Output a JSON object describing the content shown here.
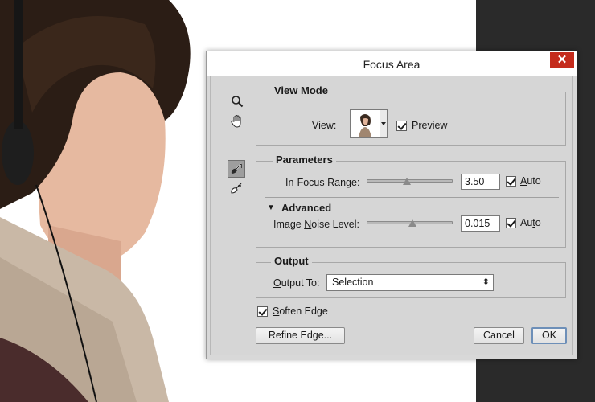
{
  "dialog": {
    "title": "Focus Area",
    "close_glyph": "✕"
  },
  "tools": [
    {
      "icon": "zoom-icon"
    },
    {
      "icon": "hand-icon"
    },
    {
      "icon": "focus-area-add-brush-icon",
      "selected": true
    },
    {
      "icon": "focus-area-subtract-brush-icon"
    }
  ],
  "view_mode": {
    "title": "View Mode",
    "view_label": "View:",
    "preview_label": "Preview",
    "preview_checked": true
  },
  "parameters": {
    "title": "Parameters",
    "in_focus_range": {
      "label_pre": "",
      "label_ul": "I",
      "label_post": "n-Focus Range:",
      "value": "3.50",
      "slider_fraction": 0.43,
      "auto_label_pre": "",
      "auto_label_ul": "A",
      "auto_label_post": "uto",
      "auto_checked": true
    },
    "advanced": {
      "label": "Advanced",
      "toggle_glyph": "▼"
    },
    "image_noise": {
      "label_pre": "Image ",
      "label_ul": "N",
      "label_post": "oise Level:",
      "value": "0.015",
      "slider_fraction": 0.48,
      "auto_label_pre": "Au",
      "auto_label_ul": "t",
      "auto_label_post": "o",
      "auto_checked": true
    }
  },
  "output": {
    "title": "Output",
    "label_pre": "",
    "label_ul": "O",
    "label_post": "utput To:",
    "selected": "Selection",
    "arrow_glyph": "⬍"
  },
  "soften_edge": {
    "label_pre": "",
    "label_ul": "S",
    "label_post": "often Edge",
    "checked": true
  },
  "buttons": {
    "refine_edge_pre": "Refine Ed",
    "refine_edge_ul": "g",
    "refine_edge_post": "e...",
    "cancel": "Cancel",
    "ok": "OK"
  }
}
